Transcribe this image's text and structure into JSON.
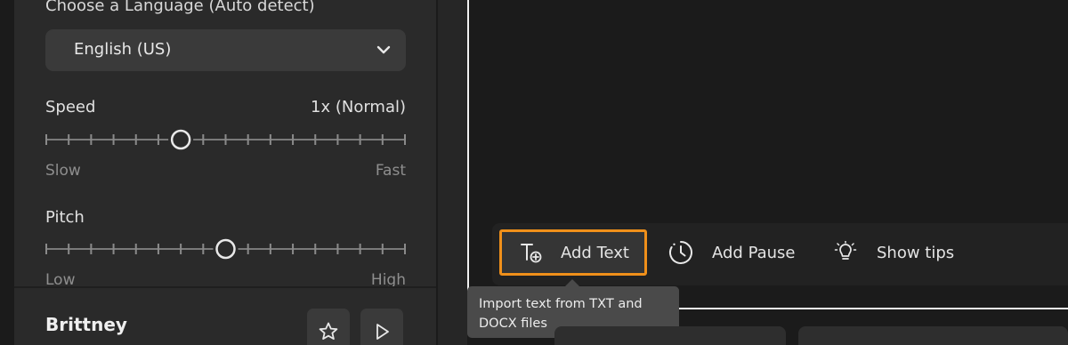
{
  "language": {
    "label": "Choose a Language (Auto detect)",
    "selected": "English (US)"
  },
  "speed": {
    "label": "Speed",
    "value": "1x (Normal)",
    "min_label": "Slow",
    "max_label": "Fast",
    "position_fraction": 0.375
  },
  "pitch": {
    "label": "Pitch",
    "min_label": "Low",
    "max_label": "High",
    "position_fraction": 0.5
  },
  "voice": {
    "name": "Brittney"
  },
  "toolbar": {
    "add_text_label": "Add Text",
    "add_pause_label": "Add Pause",
    "show_tips_label": "Show tips"
  },
  "tooltip": {
    "line1": "Import text from TXT and",
    "line2": "DOCX files"
  },
  "colors": {
    "highlight": "#f0901a",
    "background": "#1b1b1b",
    "panel": "#2a2a2a"
  }
}
